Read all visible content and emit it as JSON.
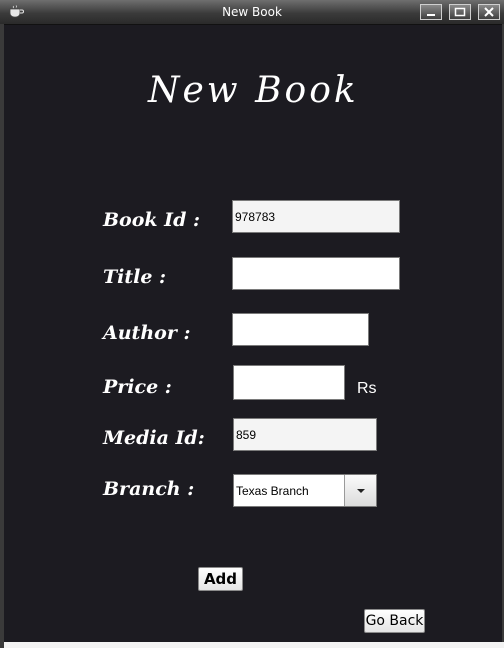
{
  "window": {
    "title": "New Book"
  },
  "form": {
    "heading": "New Book",
    "book_id_label": "Book Id :",
    "book_id_value": "978783",
    "title_label": "Title :",
    "title_value": "",
    "author_label": "Author :",
    "author_value": "",
    "price_label": "Price :",
    "price_value": "",
    "price_unit": "Rs",
    "media_id_label": "Media Id:",
    "media_id_value": "859",
    "branch_label": "Branch :",
    "branch_selected": "Texas Branch"
  },
  "buttons": {
    "add_label": "Add",
    "go_back_label": "Go Back"
  },
  "icons": {
    "app": "coffee-cup-icon",
    "minimize": "minimize-icon",
    "maximize": "maximize-icon",
    "close": "close-icon",
    "dropdown": "chevron-down-icon"
  }
}
